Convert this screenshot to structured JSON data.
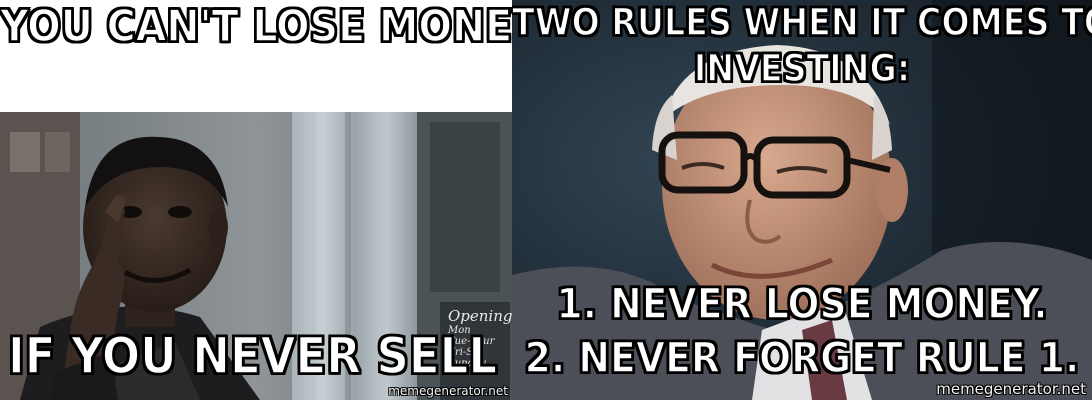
{
  "left_meme": {
    "top_text": "YOU CAN'T LOSE MONEY",
    "bottom_text": "IF YOU NEVER SELL",
    "watermark": "memegenerator.net",
    "sign": {
      "heading": "Opening",
      "line1": "Mon",
      "line2": "Tue-Thur",
      "line3": "Fri-Sat",
      "line4": "Sunday"
    }
  },
  "right_meme": {
    "top_line1": "TWO RULES WHEN IT COMES TO",
    "top_line2": "INVESTING:",
    "bottom_line1": "1. NEVER LOSE MONEY.",
    "bottom_line2": "2. NEVER FORGET RULE 1.",
    "watermark": "memegenerator.net"
  }
}
